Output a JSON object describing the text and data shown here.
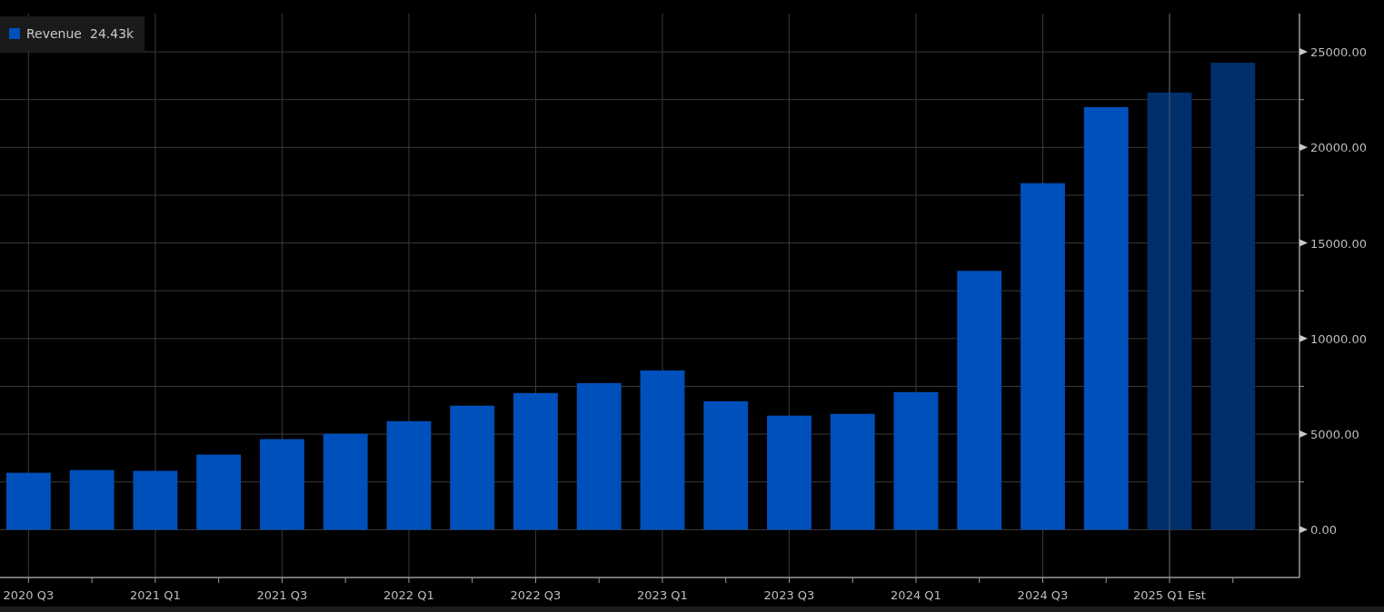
{
  "legend": {
    "value": "24.43k"
  },
  "chart_data": {
    "type": "bar",
    "categories": [
      "2020 Q3",
      null,
      "2021 Q1",
      null,
      "2021 Q3",
      null,
      "2022 Q1",
      null,
      "2022 Q3",
      null,
      "2023 Q1",
      null,
      "2023 Q3",
      null,
      "2024 Q1",
      null,
      "2024 Q3",
      null,
      "2025 Q1 Est",
      null
    ],
    "series": [
      {
        "name": "Revenue",
        "color": "#0050bb",
        "values": [
          2980,
          3120,
          3080,
          3930,
          4740,
          5020,
          5680,
          6490,
          7150,
          7670,
          8330,
          6720,
          5970,
          6060,
          7200,
          13540,
          18130,
          22110,
          null,
          null
        ]
      },
      {
        "color": "#002f6c",
        "values": [
          null,
          null,
          null,
          null,
          null,
          null,
          null,
          null,
          null,
          null,
          null,
          null,
          null,
          null,
          null,
          null,
          null,
          null,
          22870,
          24430
        ]
      }
    ],
    "grid": true,
    "ylim": [
      -2500,
      27000
    ],
    "yticks": [
      {
        "value": 0,
        "label": "0.00"
      },
      {
        "value": 5000,
        "label": "5000.00"
      },
      {
        "value": 10000,
        "label": "10000.00"
      },
      {
        "value": 15000,
        "label": "15000.00"
      },
      {
        "value": 20000,
        "label": "20000.00"
      },
      {
        "value": 25000,
        "label": "25000.00"
      }
    ]
  }
}
